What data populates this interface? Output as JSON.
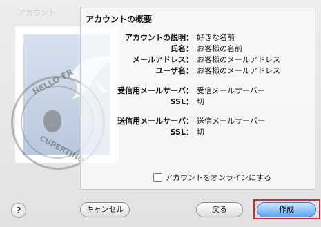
{
  "window": {
    "ghost_title": "アカウント"
  },
  "stamp": {
    "top_text": "HELLO FR",
    "bottom_text": "CUPERTINO"
  },
  "summary": {
    "title": "アカウントの概要",
    "rows": [
      {
        "label": "アカウントの説明：",
        "value": "好きな名前"
      },
      {
        "label": "氏名：",
        "value": "お客様の名前"
      },
      {
        "label": "メールアドレス：",
        "value": "お客様のメールアドレス"
      },
      {
        "label": "ユーザ名：",
        "value": "お客様のメールアドレス"
      },
      {
        "label": "受信用メールサーバ：",
        "value": "受信メールサーバー"
      },
      {
        "label": "SSL：",
        "value": "切"
      },
      {
        "label": "送信用メールサーバ：",
        "value": "送信メールサーバー"
      },
      {
        "label": "SSL：",
        "value": "切"
      }
    ],
    "online_checkbox": {
      "label": "アカウントをオンラインにする",
      "checked": false
    }
  },
  "footer": {
    "help_label": "?",
    "cancel_label": "キャンセル",
    "back_label": "戻る",
    "create_label": "作成"
  },
  "colors": {
    "highlight": "#e4232c",
    "primary_button": "#5ea5f2"
  }
}
